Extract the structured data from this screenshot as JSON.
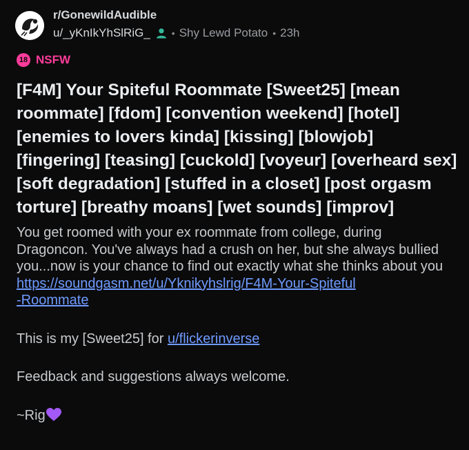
{
  "post": {
    "subreddit": "r/GonewildAudible",
    "username": "u/_yKnIkYhSlRiG_",
    "flair": "Shy Lewd Potato",
    "time": "23h",
    "nsfw_badge": "18",
    "nsfw_label": "NSFW",
    "title": "[F4M] Your Spiteful Roommate [Sweet25] [mean roommate] [fdom] [convention weekend] [hotel] [enemies to lovers kinda] [kissing] [blowjob] [fingering] [teasing] [cuckold] [voyeur] [overheard sex] [soft degradation] [stuffed in a closet] [post orgasm torture] [breathy moans] [wet sounds] [improv]",
    "body": {
      "paragraph1": "You get roomed with your ex roommate from college, during Dragoncon. You've always had a crush on her, but she always bullied you...now is your chance to find out exactly what she thinks about you",
      "link_line1": "https://soundgasm.net/u/Yknikyhslrig/F4M-Your-Spiteful",
      "link_line2": "-Roommate",
      "paragraph2_prefix": "This is my [Sweet25] for ",
      "paragraph2_link": "u/flickerinverse",
      "paragraph3": "Feedback and suggestions always welcome.",
      "signature": "~Rig"
    }
  },
  "colors": {
    "background": "#0b0b0c",
    "nsfw": "#ff3c9b",
    "link": "#6f9bff",
    "heart": "#a259f5"
  },
  "icons": {
    "avatar": "subreddit-avatar-icon",
    "user": "person-icon",
    "heart": "purple-heart-icon"
  }
}
